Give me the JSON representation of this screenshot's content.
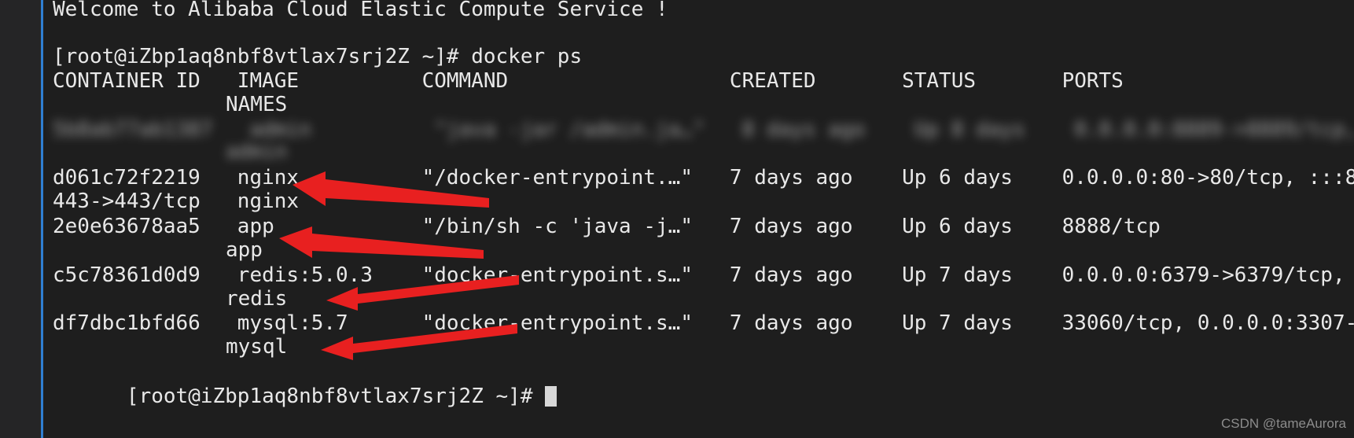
{
  "terminal": {
    "welcome": "Welcome to Alibaba Cloud Elastic Compute Service !",
    "prompt_command": "[root@iZbp1aq8nbf8vtlax7srj2Z ~]# docker ps",
    "header_line1": "CONTAINER ID   IMAGE          COMMAND                  CREATED       STATUS       PORTS",
    "header_line2": "NAMES",
    "redacted_line1": "5b8ab77ab1387   admin          \"java -jar /admin.ja…\"   8 days ago    Up 8 days    0.0.0.0:8889->8889/tcp,",
    "redacted_line2": "admin",
    "row_nginx_line1": "d061c72f2219   nginx          \"/docker-entrypoint.…\"   7 days ago    Up 6 days    0.0.0.0:80->80/tcp, :::8",
    "row_nginx_line2": "443->443/tcp   nginx",
    "row_app_line1": "2e0e63678aa5   app            \"/bin/sh -c 'java -j…\"   7 days ago    Up 6 days    8888/tcp",
    "row_app_line2": "app",
    "row_redis_line1": "c5c78361d0d9   redis:5.0.3    \"docker-entrypoint.s…\"   7 days ago    Up 7 days    0.0.0.0:6379->6379/tcp,",
    "row_redis_line2": "redis",
    "row_mysql_line1": "df7dbc1bfd66   mysql:5.7      \"docker-entrypoint.s…\"   7 days ago    Up 7 days    33060/tcp, 0.0.0.0:3307-",
    "row_mysql_line2": "mysql",
    "prompt_final": "[root@iZbp1aq8nbf8vtlax7srj2Z ~]# "
  },
  "annotations": {
    "arrow_color": "#e82020",
    "arrow_count": 4,
    "targets": [
      "nginx",
      "app",
      "redis",
      "mysql"
    ]
  },
  "watermark": {
    "text": "CSDN @tameAurora"
  },
  "colors": {
    "background": "#1e1e1e",
    "gutter": "#252526",
    "rule": "#2f7fd1",
    "text": "#e8e8e8",
    "accent_red": "#e82020"
  }
}
